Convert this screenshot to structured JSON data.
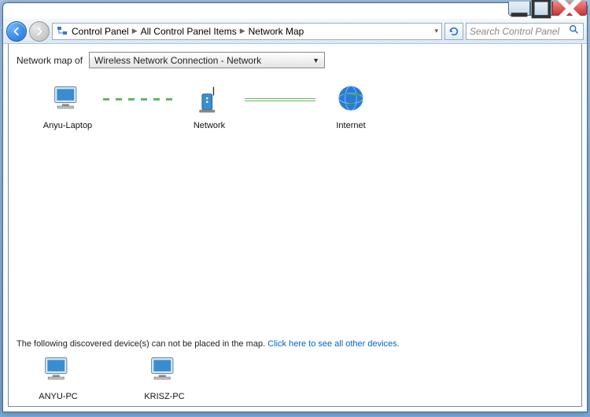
{
  "breadcrumb": {
    "items": [
      "Control Panel",
      "All Control Panel Items",
      "Network Map"
    ]
  },
  "search": {
    "placeholder": "Search Control Panel"
  },
  "header": {
    "label": "Network map of"
  },
  "dropdown": {
    "selected": "Wireless Network Connection - Network"
  },
  "nodes": {
    "this_pc": "Anyu-Laptop",
    "router": "Network",
    "internet": "Internet"
  },
  "footer": {
    "message": "The following discovered device(s) can not be placed in the map.",
    "link": "Click here to see all other devices."
  },
  "devices": [
    "ANYU-PC",
    "KRISZ-PC"
  ]
}
